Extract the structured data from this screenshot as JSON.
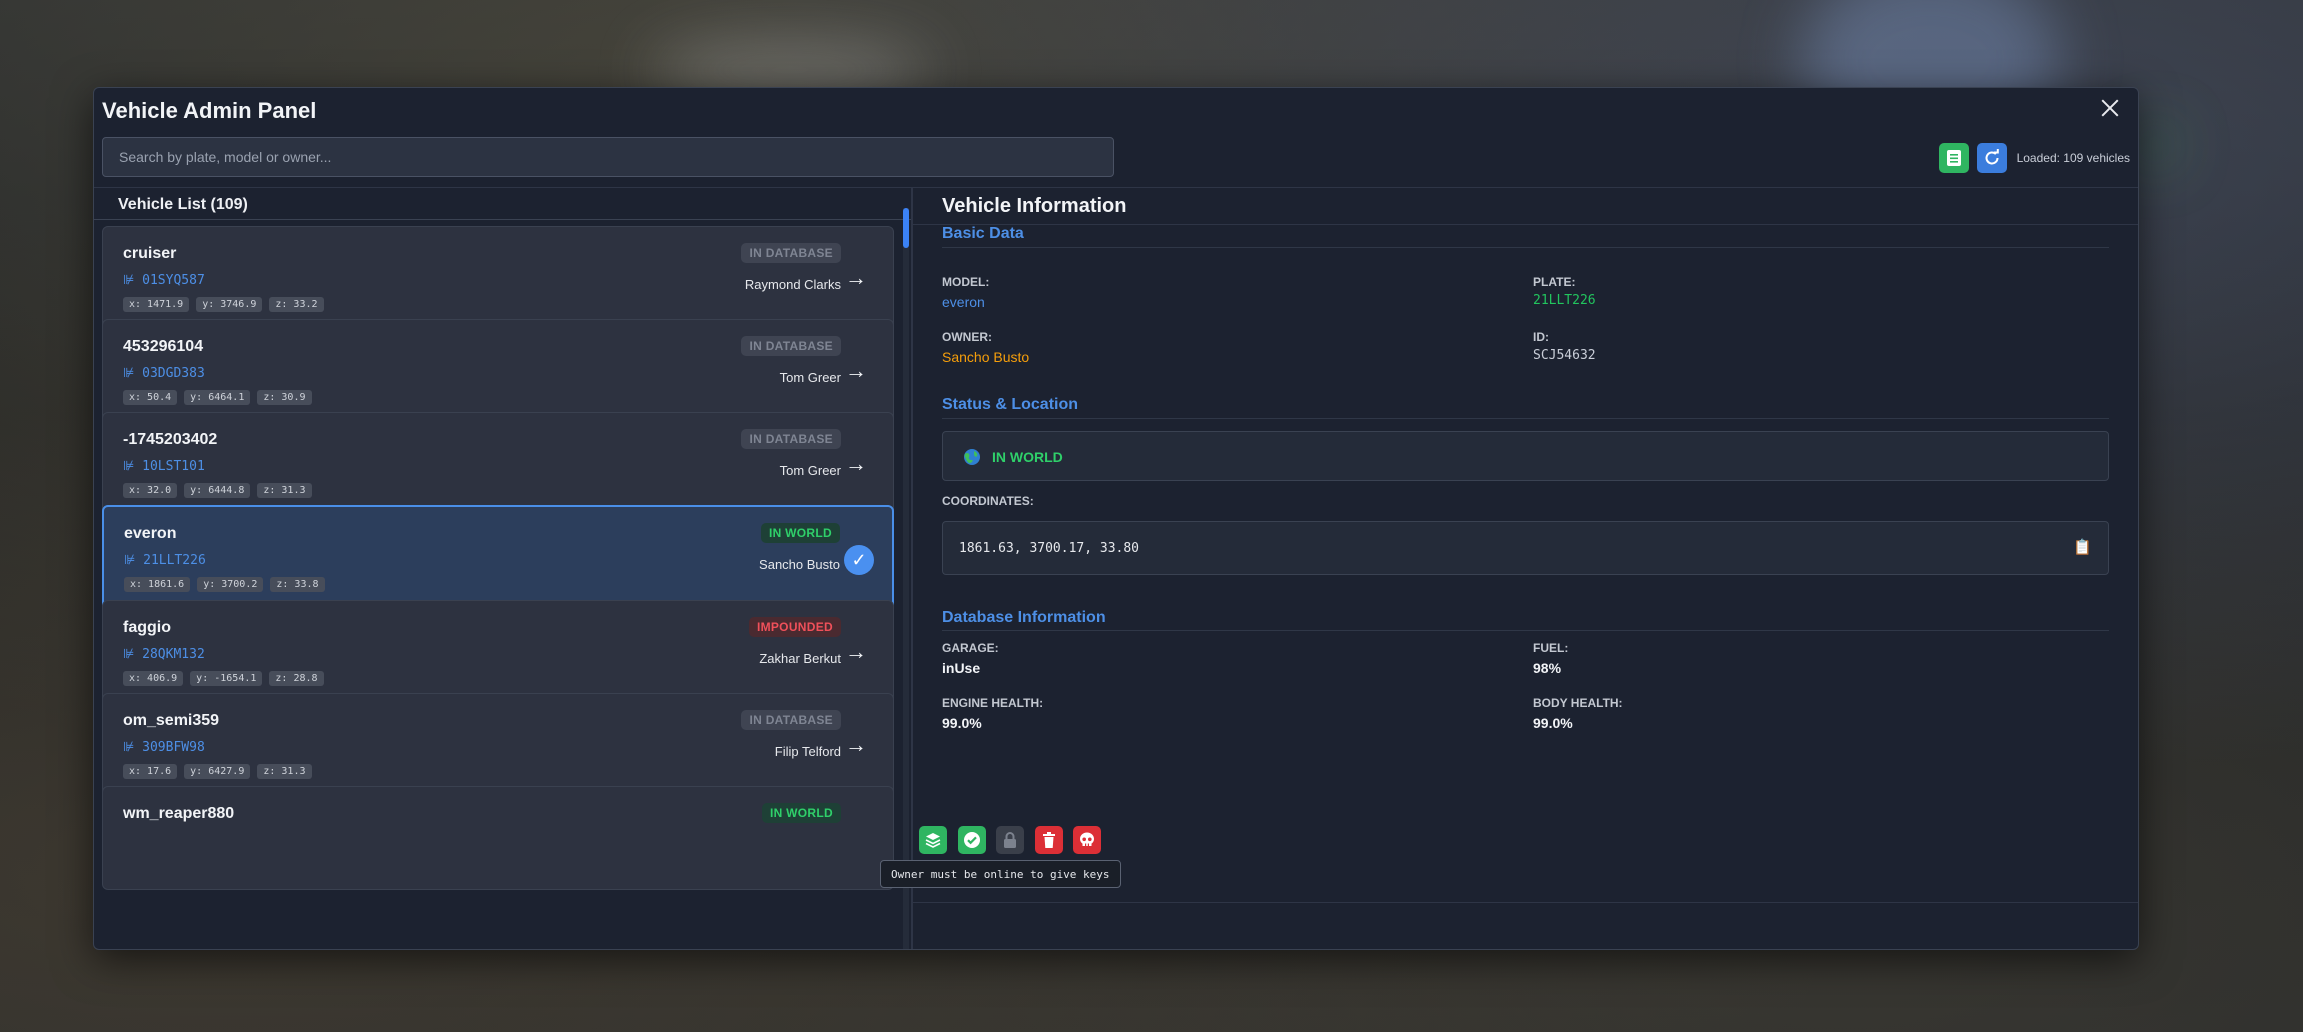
{
  "panel": {
    "title": "Vehicle Admin Panel",
    "search_placeholder": "Search by plate, model or owner...",
    "loaded_text": "Loaded: 109 vehicles",
    "icons": [
      "close-icon",
      "list-icon",
      "refresh-icon"
    ]
  },
  "list": {
    "heading": "Vehicle List (109)",
    "vehicles": [
      {
        "model": "cruiser",
        "plate": "01SYQ587",
        "x": "x: 1471.9",
        "y": "y: 3746.9",
        "z": "z: 33.2",
        "status": "IN DATABASE",
        "owner": "Raymond Clarks"
      },
      {
        "model": "453296104",
        "plate": "03DGD383",
        "x": "x: 50.4",
        "y": "y: 6464.1",
        "z": "z: 30.9",
        "status": "IN DATABASE",
        "owner": "Tom Greer"
      },
      {
        "model": "-1745203402",
        "plate": "10LST101",
        "x": "x: 32.0",
        "y": "y: 6444.8",
        "z": "z: 31.3",
        "status": "IN DATABASE",
        "owner": "Tom Greer"
      },
      {
        "model": "everon",
        "plate": "21LLT226",
        "x": "x: 1861.6",
        "y": "y: 3700.2",
        "z": "z: 33.8",
        "status": "IN WORLD",
        "owner": "Sancho Busto",
        "selected": true
      },
      {
        "model": "faggio",
        "plate": "28QKM132",
        "x": "x: 406.9",
        "y": "y: -1654.1",
        "z": "z: 28.8",
        "status": "IMPOUNDED",
        "owner": "Zakhar Berkut"
      },
      {
        "model": "om_semi359",
        "plate": "309BFW98",
        "x": "x: 17.6",
        "y": "y: 6427.9",
        "z": "z: 31.3",
        "status": "IN DATABASE",
        "owner": "Filip Telford"
      },
      {
        "model": "wm_reaper880",
        "status": "IN WORLD"
      }
    ],
    "arrow": "→",
    "check": "✓"
  },
  "info": {
    "heading": "Vehicle Information",
    "basic": {
      "title": "Basic Data",
      "model_label": "MODEL:",
      "model_value": "everon",
      "plate_label": "PLATE:",
      "plate_value": "21LLT226",
      "owner_label": "OWNER:",
      "owner_value": "Sancho Busto",
      "id_label": "ID:",
      "id_value": "SCJ54632"
    },
    "status": {
      "title": "Status & Location",
      "state": "IN WORLD",
      "state_icon": "globe-icon",
      "coords_label": "COORDINATES:",
      "coords_value": "1861.63, 3700.17, 33.80",
      "copy_icon": "📋"
    },
    "database": {
      "title": "Database Information",
      "garage_label": "GARAGE:",
      "garage_value": "inUse",
      "fuel_label": "FUEL:",
      "fuel_value": "98%",
      "engine_label": "ENGINE HEALTH:",
      "engine_value": "99.0%",
      "body_label": "BODY HEALTH:",
      "body_value": "99.0%"
    }
  },
  "actions": {
    "tooltip": "Owner must be online to give keys",
    "icons": [
      "layers-icon",
      "check-circle-icon",
      "lock-icon",
      "trash-icon",
      "skull-icon"
    ]
  },
  "colors": {
    "accent_blue": "#4d8fe6",
    "plate_green": "#22c55e",
    "owner_orange": "#f59e0b",
    "status_green": "#2fd06a",
    "impound_red": "#f0505a"
  }
}
